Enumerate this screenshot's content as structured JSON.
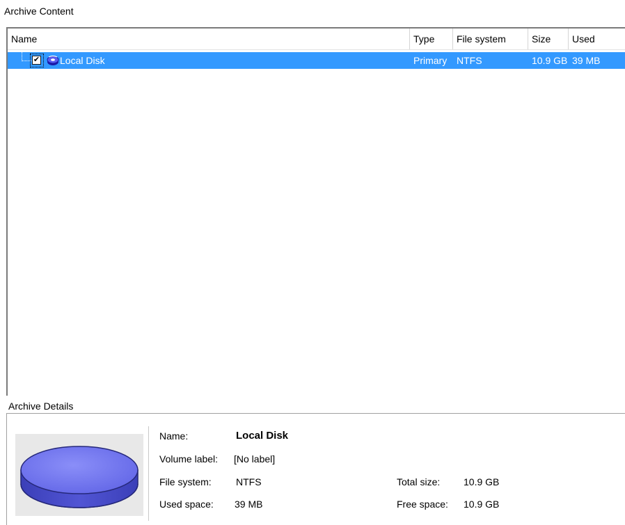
{
  "archive_content": {
    "title": "Archive Content",
    "columns": [
      "Name",
      "Type",
      "File system",
      "Size",
      "Used"
    ],
    "rows": [
      {
        "name": "Local Disk",
        "type": "Primary",
        "file_system": "NTFS",
        "size": "10.9 GB",
        "used": "39 MB",
        "checked": true,
        "selected": true,
        "icon": "disk-icon"
      }
    ]
  },
  "archive_details": {
    "title": "Archive Details",
    "name_label": "Name:",
    "name_value": "Local Disk",
    "volume_label_label": "Volume label:",
    "volume_label_value": "[No label]",
    "file_system_label": "File system:",
    "file_system_value": "NTFS",
    "used_space_label": "Used space:",
    "used_space_value": "39 MB",
    "total_size_label": "Total size:",
    "total_size_value": "10.9 GB",
    "free_space_label": "Free space:",
    "free_space_value": "10.9 GB"
  },
  "colors": {
    "selection": "#3399ff",
    "disk_fill": "#7a7ef0"
  }
}
